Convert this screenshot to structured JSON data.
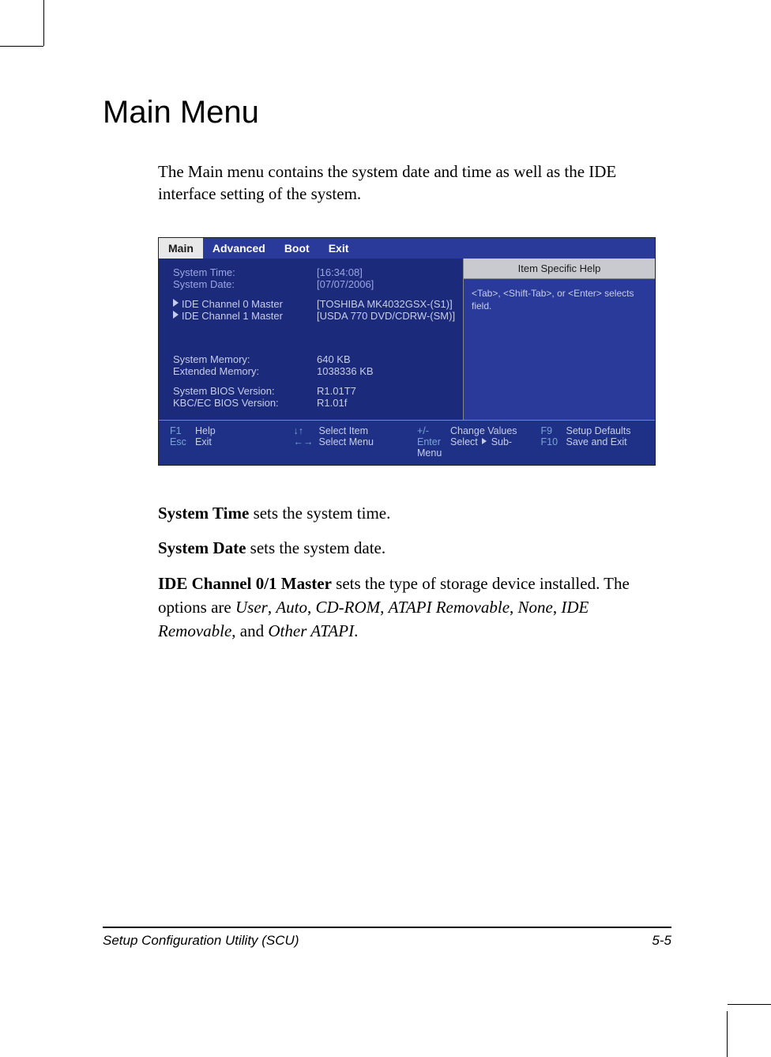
{
  "heading": "Main Menu",
  "intro": "The Main menu contains the system date and time as well as the IDE interface setting of the system.",
  "bios": {
    "tabs": [
      "Main",
      "Advanced",
      "Boot",
      "Exit"
    ],
    "active_tab": "Main",
    "rows": {
      "system_time_label": "System Time:",
      "system_time_value": "[16:34:08]",
      "system_date_label": "System Date:",
      "system_date_value": "[07/07/2006]",
      "ide0_label": "IDE Channel 0 Master",
      "ide0_value": "[TOSHIBA MK4032GSX-(S1)]",
      "ide1_label": "IDE Channel 1 Master",
      "ide1_value": "[USDA 770 DVD/CDRW-(SM)]",
      "sysmem_label": "System Memory:",
      "sysmem_value": "640 KB",
      "extmem_label": "Extended Memory:",
      "extmem_value": "1038336 KB",
      "biosver_label": "System BIOS Version:",
      "biosver_value": "R1.01T7",
      "kbcver_label": "KBC/EC BIOS Version:",
      "kbcver_value": "R1.01f"
    },
    "help": {
      "title": "Item Specific Help",
      "body": "<Tab>, <Shift-Tab>, or <Enter> selects field."
    },
    "footer": {
      "f1": "F1",
      "help": "Help",
      "esc": "Esc",
      "exit": "Exit",
      "updn": "↓↑",
      "select_item": "Select Item",
      "lr": "←→",
      "select_menu": "Select Menu",
      "pm": "+/-",
      "change_values": "Change Values",
      "enter": "Enter",
      "sub_menu": "Select ▶ Sub-Menu",
      "f9": "F9",
      "setup_defaults": "Setup Defaults",
      "f10": "F10",
      "save_exit": "Save and Exit"
    }
  },
  "definitions": {
    "system_time_term": "System Time",
    "system_time_desc": "  sets the system time.",
    "system_date_term": "System Date",
    "system_date_desc": "  sets the system date.",
    "ide_term": "IDE Channel 0/1 Master",
    "ide_desc_pre": "  sets the type of storage device installed. The options are ",
    "ide_opts": [
      "User",
      "Auto",
      "CD-ROM",
      "ATAPI Removable",
      "None",
      "IDE Removable",
      "Other ATAPI"
    ],
    "ide_sep": ", ",
    "ide_and": ", and ",
    "ide_end": "."
  },
  "footer": {
    "left": "Setup Configuration Utility (SCU)",
    "right": "5-5"
  }
}
